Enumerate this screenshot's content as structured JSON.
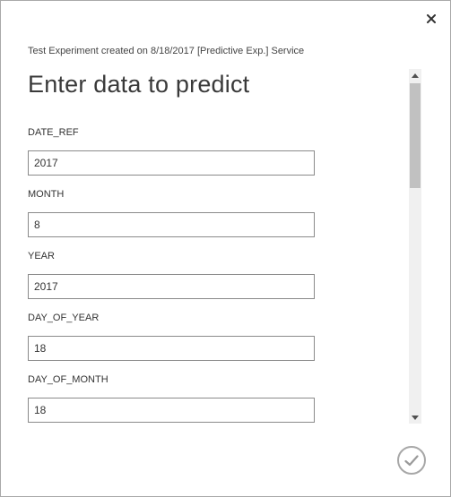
{
  "dialog": {
    "subtitle": "Test Experiment created on 8/18/2017 [Predictive Exp.] Service",
    "title": "Enter data to predict"
  },
  "fields": [
    {
      "label": "DATE_REF",
      "value": "2017"
    },
    {
      "label": "MONTH",
      "value": "8"
    },
    {
      "label": "YEAR",
      "value": "2017"
    },
    {
      "label": "DAY_OF_YEAR",
      "value": "18"
    },
    {
      "label": "DAY_OF_MONTH",
      "value": "18"
    }
  ],
  "icons": {
    "close": "close-icon",
    "confirm": "checkmark-icon",
    "scroll_up": "arrow-up-icon",
    "scroll_down": "arrow-down-icon"
  },
  "colors": {
    "border": "#a9a9a9",
    "input_border": "#8a8a8a",
    "scroll_thumb": "#c1c1c1",
    "confirm_ring": "#a7a7a7"
  }
}
